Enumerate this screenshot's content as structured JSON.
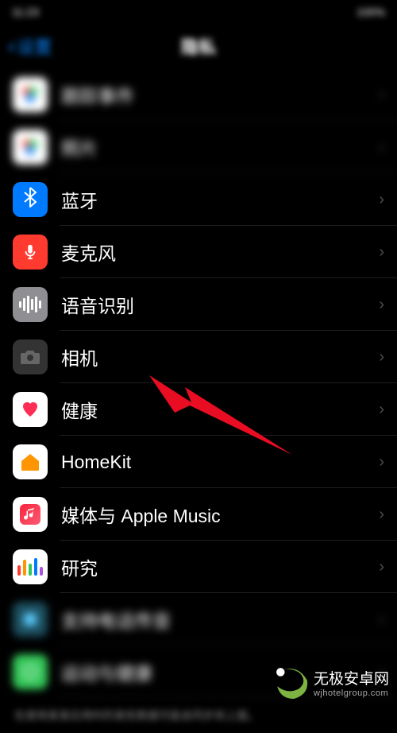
{
  "statusBar": {
    "left": "11:23",
    "right": "100%"
  },
  "nav": {
    "back": "设置",
    "title": "隐私"
  },
  "items": [
    {
      "label": "跟踪事件",
      "iconType": "multi",
      "blurred": true
    },
    {
      "label": "照片",
      "iconType": "multi",
      "blurred": true
    },
    {
      "label": "蓝牙",
      "iconType": "bluetooth",
      "blurred": false
    },
    {
      "label": "麦克风",
      "iconType": "mic",
      "blurred": false
    },
    {
      "label": "语音识别",
      "iconType": "wave",
      "blurred": false
    },
    {
      "label": "相机",
      "iconType": "camera",
      "blurred": false
    },
    {
      "label": "健康",
      "iconType": "heart",
      "blurred": false
    },
    {
      "label": "HomeKit",
      "iconType": "home",
      "blurred": false
    },
    {
      "label": "媒体与 Apple Music",
      "iconType": "music",
      "blurred": false
    },
    {
      "label": "研究",
      "iconType": "research",
      "blurred": false
    },
    {
      "label": "支持电话传音",
      "iconType": "teal",
      "blurred": true
    },
    {
      "label": "运动与健康",
      "iconType": "green",
      "blurred": true
    }
  ],
  "footer": "在使用某某应用时的某些数据可能会同步到上面。",
  "watermark": {
    "name": "无极安卓网",
    "url": "wjhotelgroup.com"
  }
}
